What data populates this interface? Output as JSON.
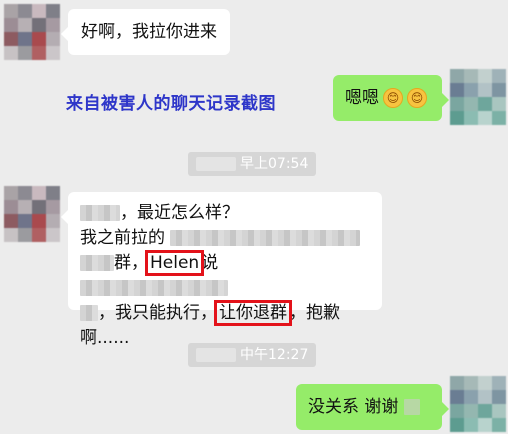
{
  "messages": {
    "m1": {
      "text": "好啊，我拉你进来"
    },
    "caption": "来自被害人的聊天记录截图",
    "m2": {
      "text": "嗯嗯",
      "emojis": [
        "😊",
        "😊"
      ]
    },
    "time1": "早上07:54",
    "m3": {
      "line1": "，最近怎么样？",
      "line2": "我之前拉的",
      "line3a": "群，",
      "line3_highlight": "Helen",
      "line3b": "说",
      "line4a": "，我只能执行，",
      "line4_highlight": "让你退群",
      "line4b": "，抱歉啊......"
    },
    "time2": "中午12:27",
    "m4": {
      "text": "没关系 谢谢"
    }
  },
  "colors": {
    "background": "#ececec",
    "incoming_bubble": "#ffffff",
    "outgoing_bubble": "#95ec69",
    "caption": "#2e36c9",
    "highlight_box": "#e3121a",
    "timestamp_bg": "#d6d6d6"
  },
  "icons": {
    "avatar_left": "pixelated-avatar",
    "avatar_right": "pixelated-avatar",
    "emoji": "smiling-face-icon"
  }
}
